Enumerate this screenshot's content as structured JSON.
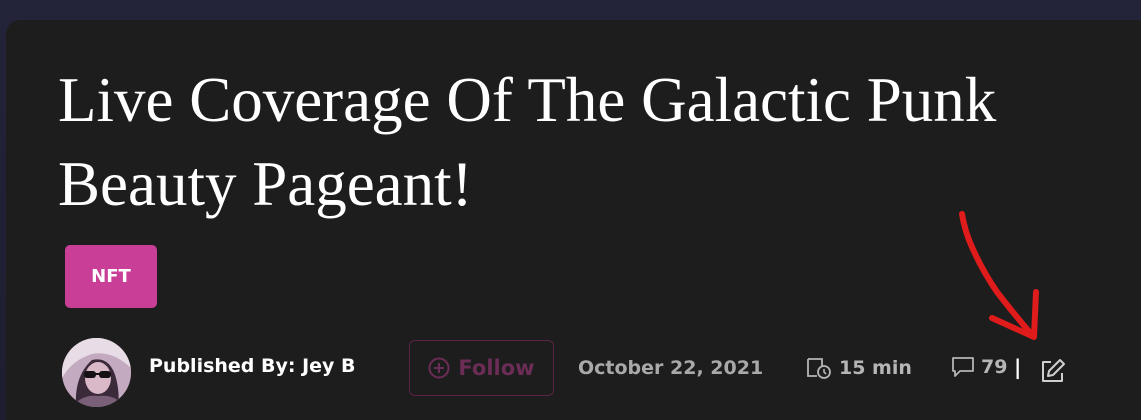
{
  "article": {
    "title_line1": "Live Coverage Of The Galactic Punk",
    "title_line2": "Beauty Pageant!",
    "tag": "NFT"
  },
  "meta": {
    "author": "Published By: Jey B",
    "follow_label": "Follow",
    "date": "October 22, 2021",
    "read_time": "15 min",
    "comments_count": "79",
    "separator": "|"
  },
  "icons": {
    "follow": "plus-circle-icon",
    "read_time": "clock-book-icon",
    "comments": "comment-icon",
    "edit": "edit-icon",
    "annotation": "red-arrow-annotation"
  },
  "colors": {
    "page_background": "#23233a",
    "card_background": "#1d1d1d",
    "tag_background": "#c93f97",
    "follow_text": "#6b2c56",
    "follow_border": "#5a2348",
    "meta_text": "#a9a9a9",
    "annotation": "#e01b1b"
  }
}
